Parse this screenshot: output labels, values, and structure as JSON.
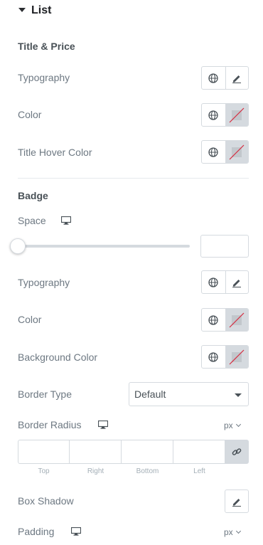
{
  "section": {
    "title": "List"
  },
  "title_price": {
    "heading": "Title & Price",
    "typography_label": "Typography",
    "color_label": "Color",
    "title_hover_color_label": "Title Hover Color"
  },
  "badge": {
    "heading": "Badge",
    "space_label": "Space",
    "space_value": "",
    "typography_label": "Typography",
    "color_label": "Color",
    "background_color_label": "Background Color",
    "border_type_label": "Border Type",
    "border_type_value": "Default",
    "border_radius_label": "Border Radius",
    "border_radius_unit": "px",
    "dimensions": [
      "Top",
      "Right",
      "Bottom",
      "Left"
    ],
    "box_shadow_label": "Box Shadow",
    "padding_label": "Padding",
    "padding_unit": "px"
  },
  "colors": {
    "accent_none_slash": "#d72b3f",
    "swatch_bg": "#d5dadf",
    "border": "#d5dadf"
  },
  "icons": [
    "caret-down-icon",
    "globe-icon",
    "pencil-icon",
    "no-color-icon",
    "desktop-icon",
    "link-icon",
    "chevron-down-icon"
  ]
}
